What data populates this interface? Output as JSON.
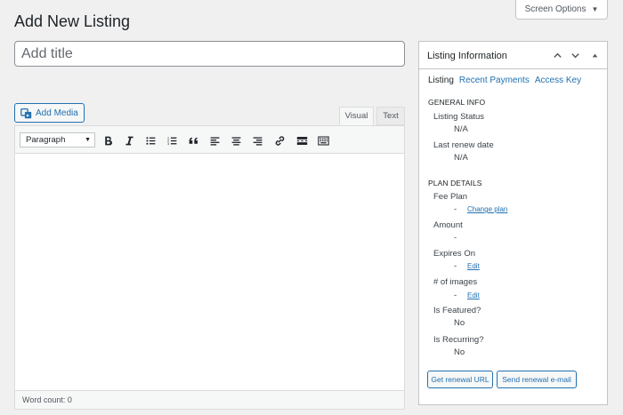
{
  "screen_options": {
    "label": "Screen Options",
    "caret": "▼"
  },
  "page_title": "Add New Listing",
  "title_input": {
    "placeholder": "Add title",
    "value": ""
  },
  "add_media": {
    "label": "Add Media"
  },
  "editor_tabs": {
    "visual": "Visual",
    "text": "Text"
  },
  "toolbar": {
    "format_select": {
      "selected": "Paragraph",
      "caret": "▼"
    },
    "buttons": [
      "bold",
      "italic",
      "bulleted-list",
      "numbered-list",
      "blockquote",
      "align-left",
      "align-center",
      "align-right",
      "insert-link",
      "read-more",
      "toolbar-toggle"
    ]
  },
  "status_bar": {
    "word_count": "Word count: 0"
  },
  "panel": {
    "title": "Listing Information",
    "tabs": [
      {
        "label": "Listing",
        "active": true
      },
      {
        "label": "Recent Payments",
        "active": false
      },
      {
        "label": "Access Key",
        "active": false
      }
    ],
    "general_info": {
      "heading": "GENERAL INFO",
      "listing_status_label": "Listing Status",
      "listing_status_value": "N/A",
      "last_renew_label": "Last renew date",
      "last_renew_value": "N/A"
    },
    "plan_details": {
      "heading": "PLAN DETAILS",
      "fee_plan_label": "Fee Plan",
      "fee_plan_value": "-",
      "fee_plan_link": "Change plan",
      "amount_label": "Amount",
      "amount_value": "-",
      "expires_label": "Expires On",
      "expires_value": "-",
      "expires_link": "Edit",
      "images_label": "# of images",
      "images_value": "-",
      "images_link": "Edit",
      "featured_label": "Is Featured?",
      "featured_value": "No",
      "recurring_label": "Is Recurring?",
      "recurring_value": "No"
    },
    "buttons": {
      "renewal_url": "Get renewal URL",
      "renewal_email": "Send renewal e-mail"
    }
  },
  "colors": {
    "accent": "#2271b1",
    "background": "#f0f0f1",
    "border": "#c3c4c7"
  }
}
